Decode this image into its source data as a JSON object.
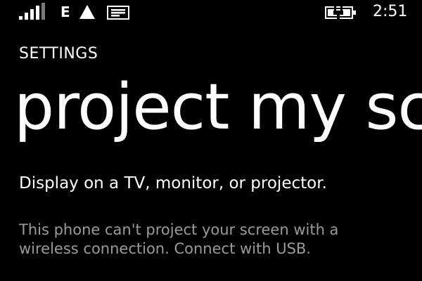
{
  "status_bar": {
    "network_type": "E",
    "signal_icon": "signal-strength-icon",
    "wifi_icon": "wifi-icon",
    "notification_icon": "message-notification-icon",
    "battery_icon": "battery-charging-icon",
    "time": "2:51"
  },
  "page": {
    "breadcrumb": "SETTINGS",
    "title": "project my screen",
    "subtitle": "Display on a TV, monitor, or projector.",
    "description": "This phone can't project your screen with a wireless connection. Connect with USB."
  },
  "colors": {
    "background": "#000000",
    "text": "#ffffff",
    "secondary_text": "#9a9a9a"
  }
}
